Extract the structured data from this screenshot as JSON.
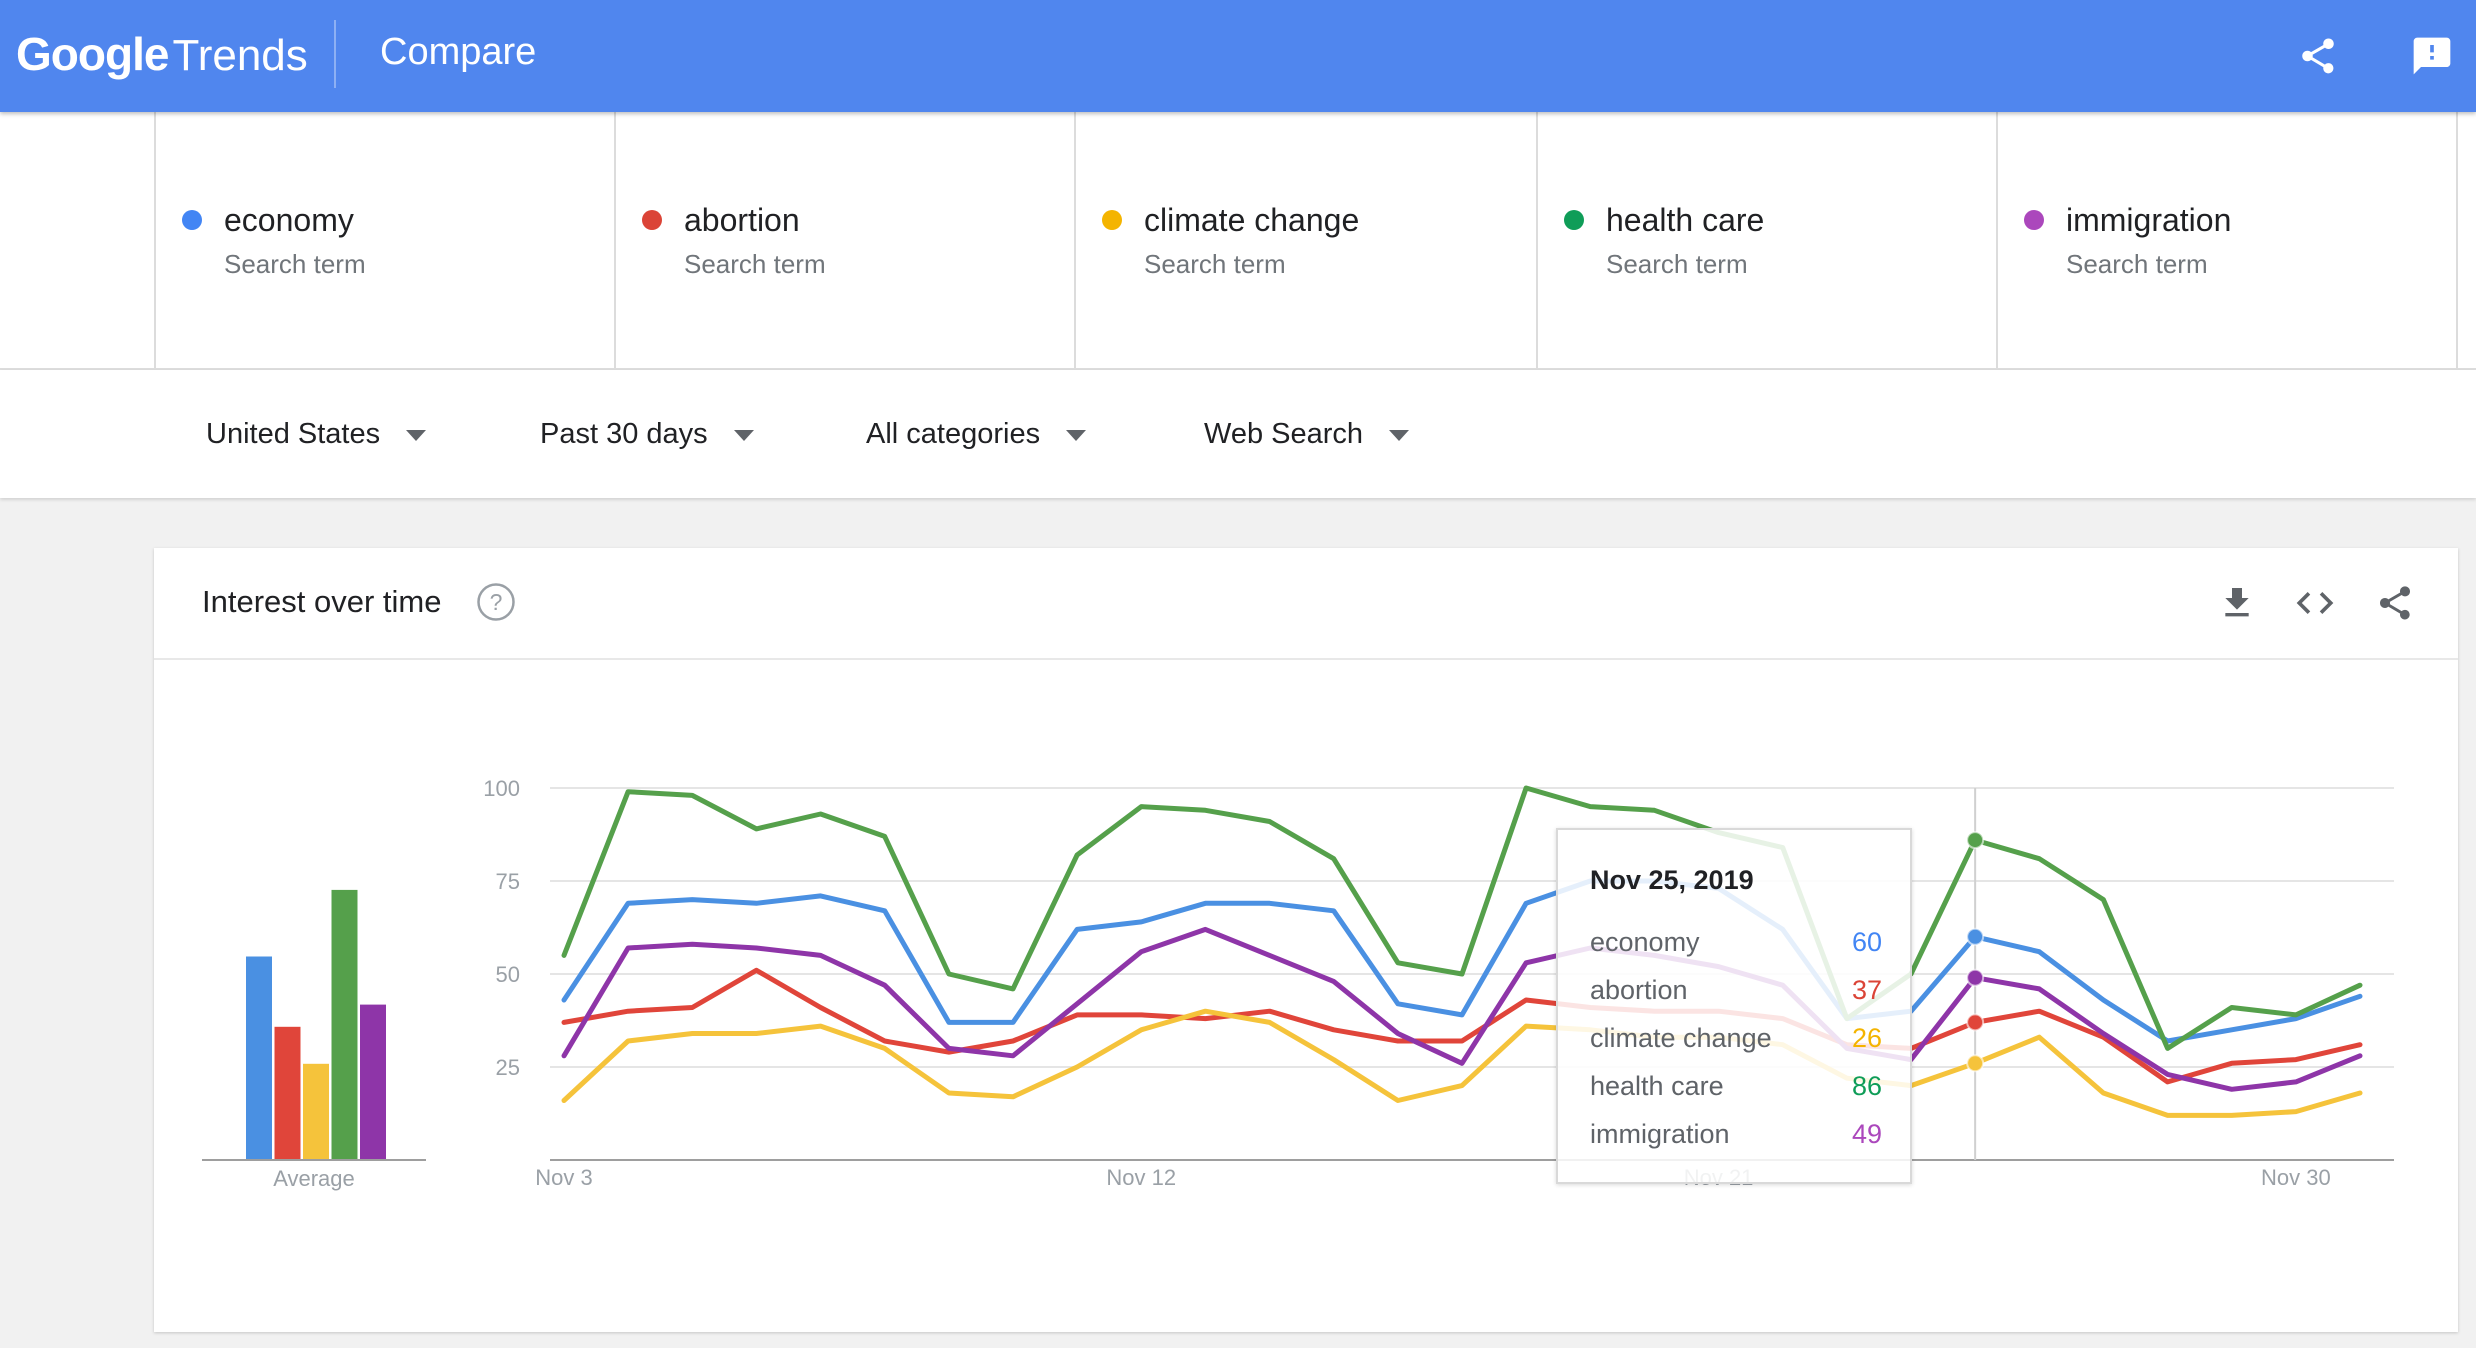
{
  "header": {
    "brand_google": "Google",
    "brand_trends": "Trends",
    "title": "Compare",
    "share_icon": "share-icon",
    "feedback_icon": "feedback-icon"
  },
  "terms": [
    {
      "name": "economy",
      "type": "Search term",
      "color": "#4285F4"
    },
    {
      "name": "abortion",
      "type": "Search term",
      "color": "#DB4437"
    },
    {
      "name": "climate change",
      "type": "Search term",
      "color": "#F4B400"
    },
    {
      "name": "health care",
      "type": "Search term",
      "color": "#0F9D58"
    },
    {
      "name": "immigration",
      "type": "Search term",
      "color": "#AB47BC"
    }
  ],
  "filters": {
    "region": "United States",
    "time": "Past 30 days",
    "category": "All categories",
    "search_type": "Web Search"
  },
  "card": {
    "title": "Interest over time",
    "icons": [
      "help-icon",
      "download-icon",
      "embed-icon",
      "share-icon"
    ]
  },
  "chart_data": {
    "type": "line",
    "title": "Interest over time",
    "x": [
      "Nov 3",
      "Nov 4",
      "Nov 5",
      "Nov 6",
      "Nov 7",
      "Nov 8",
      "Nov 9",
      "Nov 10",
      "Nov 11",
      "Nov 12",
      "Nov 13",
      "Nov 14",
      "Nov 15",
      "Nov 16",
      "Nov 17",
      "Nov 18",
      "Nov 19",
      "Nov 20",
      "Nov 21",
      "Nov 22",
      "Nov 23",
      "Nov 24",
      "Nov 25",
      "Nov 26",
      "Nov 27",
      "Nov 28",
      "Nov 29",
      "Nov 30",
      "Dec 1"
    ],
    "x_tick_labels": [
      "Nov 3",
      "Nov 12",
      "Nov 21",
      "Nov 30"
    ],
    "y_ticks": [
      25,
      50,
      75,
      100
    ],
    "ylim": [
      0,
      100
    ],
    "grid": true,
    "series": [
      {
        "name": "economy",
        "color": "#4A90E2",
        "values": [
          43,
          69,
          70,
          69,
          71,
          67,
          37,
          37,
          62,
          64,
          69,
          69,
          67,
          42,
          39,
          69,
          75,
          75,
          73,
          62,
          38,
          40,
          60,
          56,
          43,
          32,
          35,
          38,
          44
        ]
      },
      {
        "name": "abortion",
        "color": "#E0453A",
        "values": [
          37,
          40,
          41,
          51,
          41,
          32,
          29,
          32,
          39,
          39,
          38,
          40,
          35,
          32,
          32,
          43,
          41,
          40,
          40,
          38,
          31,
          30,
          37,
          40,
          33,
          21,
          26,
          27,
          31
        ]
      },
      {
        "name": "climate change",
        "color": "#F5C33B",
        "values": [
          16,
          32,
          34,
          34,
          36,
          30,
          18,
          17,
          25,
          35,
          40,
          37,
          27,
          16,
          20,
          36,
          35,
          33,
          33,
          31,
          22,
          20,
          26,
          33,
          18,
          12,
          12,
          13,
          18
        ]
      },
      {
        "name": "health care",
        "color": "#55A04B",
        "values": [
          55,
          99,
          98,
          89,
          93,
          87,
          50,
          46,
          82,
          95,
          94,
          91,
          81,
          53,
          50,
          100,
          95,
          94,
          88,
          84,
          38,
          50,
          86,
          81,
          70,
          30,
          41,
          39,
          47
        ]
      },
      {
        "name": "immigration",
        "color": "#8E35A8",
        "values": [
          28,
          57,
          58,
          57,
          55,
          47,
          30,
          28,
          42,
          56,
          62,
          55,
          48,
          34,
          26,
          53,
          57,
          55,
          52,
          47,
          30,
          27,
          49,
          46,
          34,
          23,
          19,
          21,
          28
        ]
      }
    ],
    "average": {
      "label": "Average",
      "values": [
        55,
        36,
        26,
        73,
        42
      ]
    },
    "hover_index": 22,
    "tooltip": {
      "date": "Nov 25, 2019",
      "rows": [
        {
          "name": "economy",
          "value": "60",
          "color": "#4285F4"
        },
        {
          "name": "abortion",
          "value": "37",
          "color": "#DB4437"
        },
        {
          "name": "climate change",
          "value": "26",
          "color": "#F4B400"
        },
        {
          "name": "health care",
          "value": "86",
          "color": "#0F9D58"
        },
        {
          "name": "immigration",
          "value": "49",
          "color": "#AB47BC"
        }
      ]
    }
  }
}
